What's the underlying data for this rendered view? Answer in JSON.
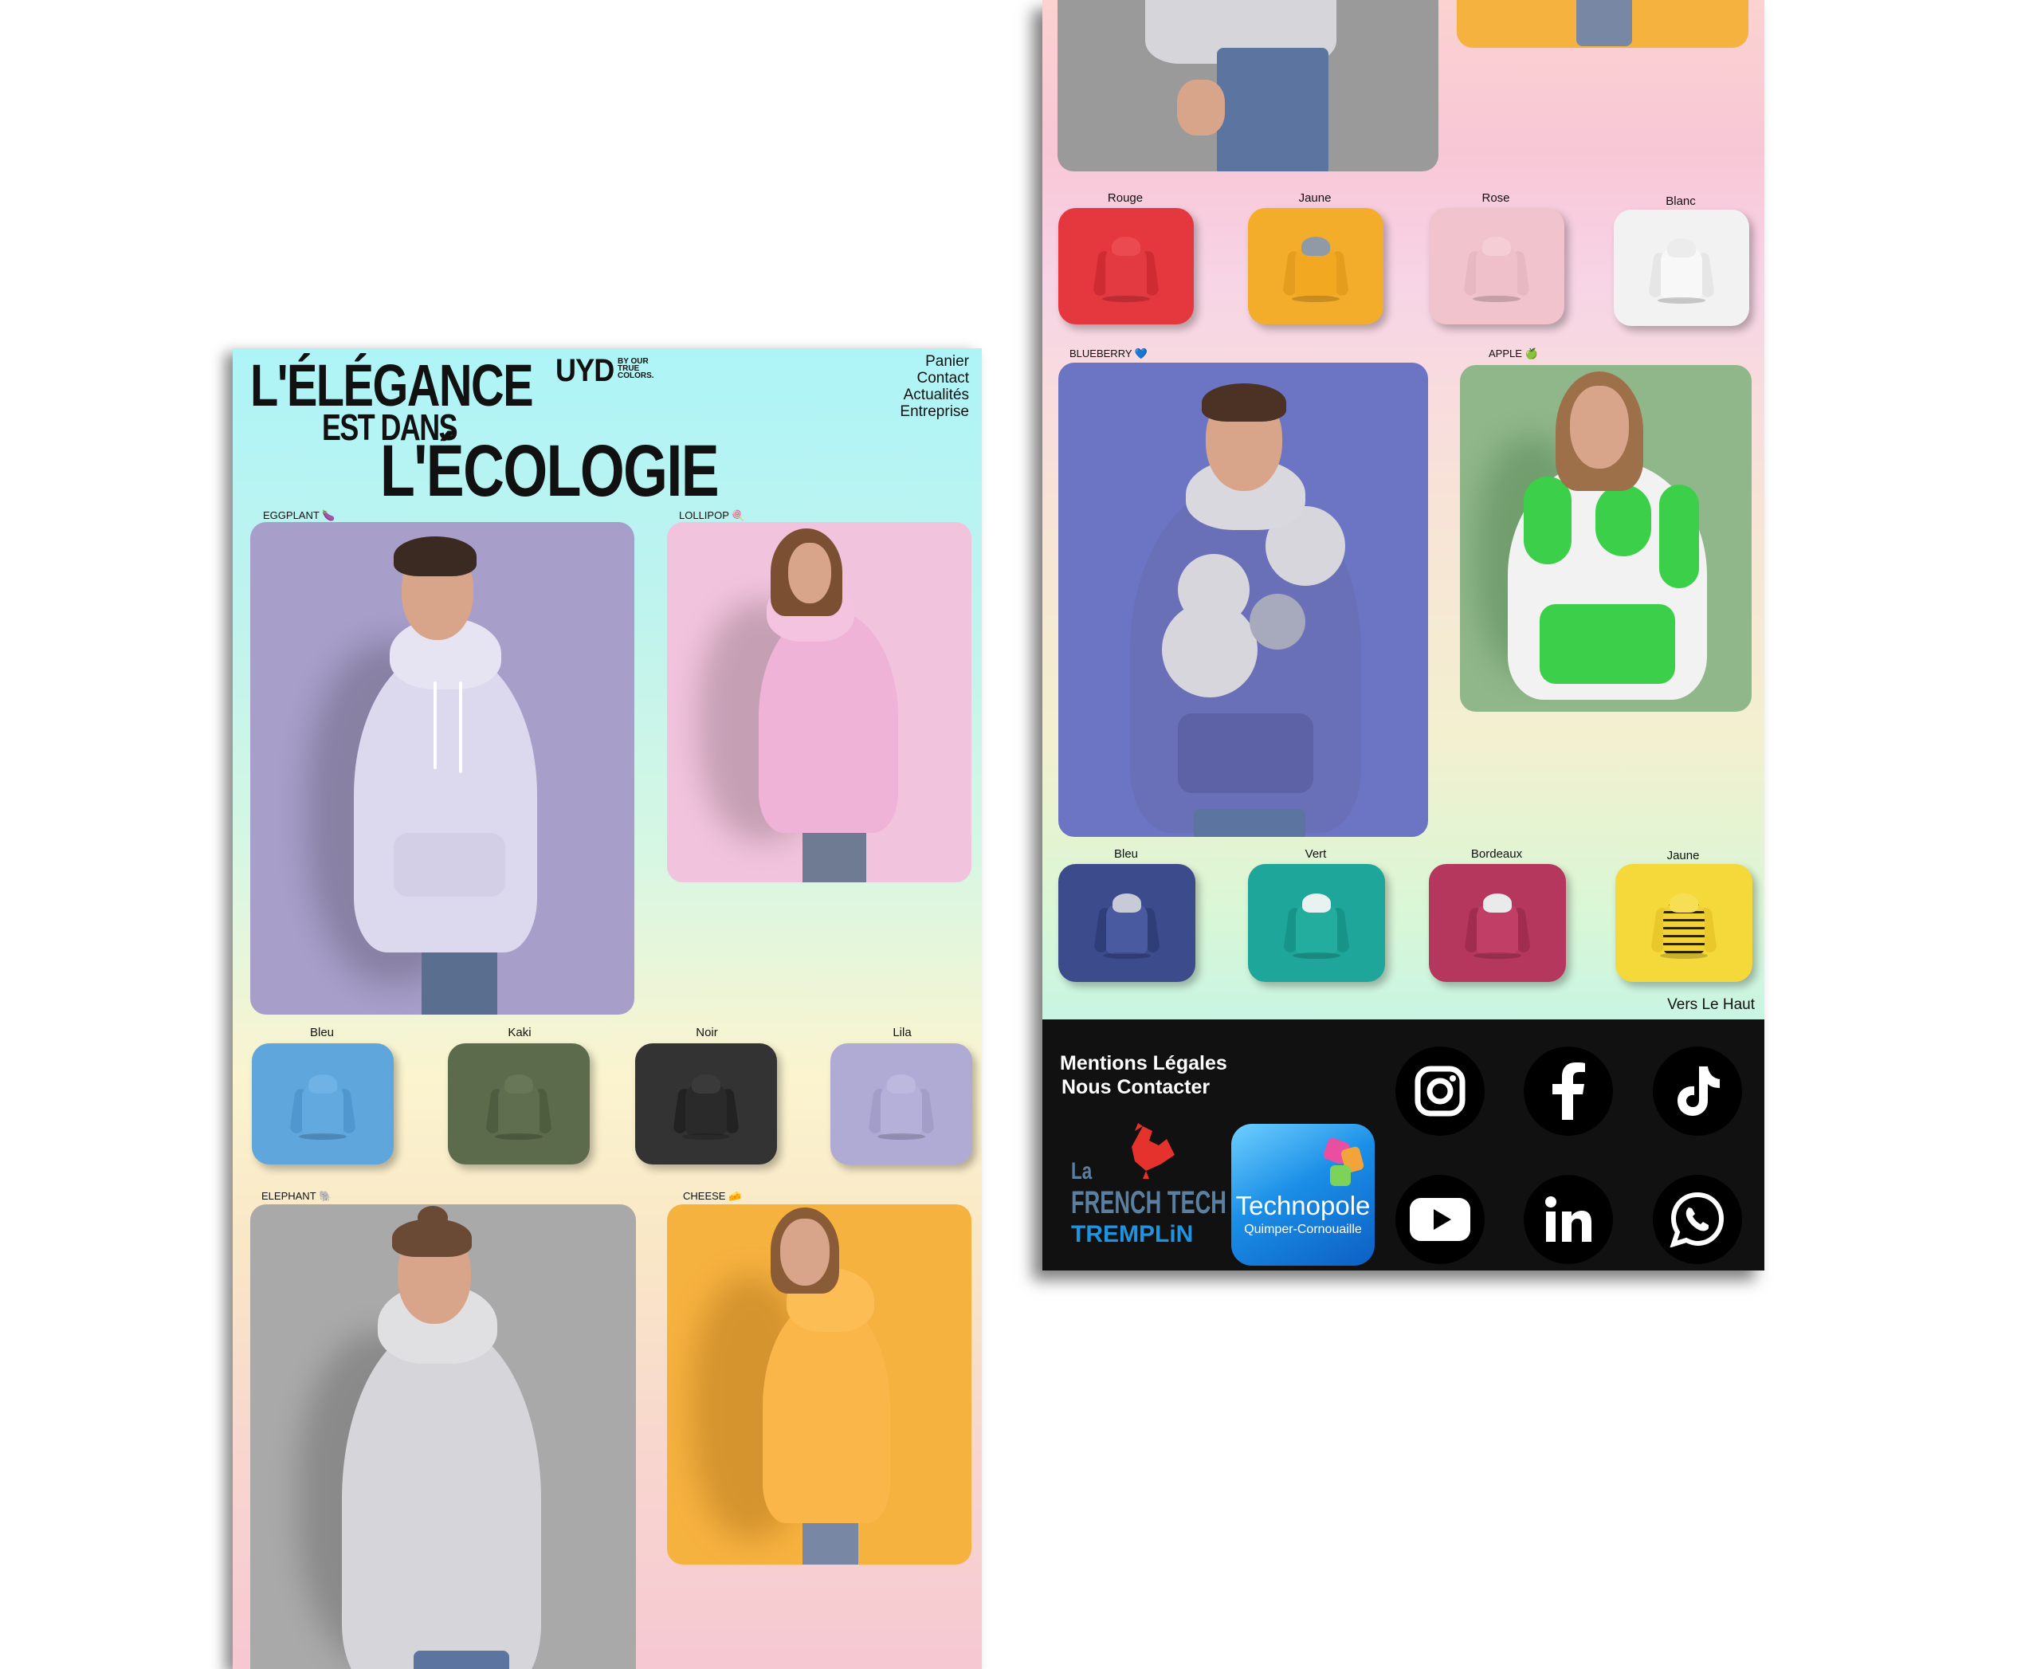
{
  "hero": {
    "line1": "L'ÉLÉGANCE",
    "line2": "EST DANS",
    "line3": "L'ÉCOLOGIE"
  },
  "brand": {
    "logo": "UYD",
    "tagline": "BY OUR TRUE COLORS."
  },
  "nav": {
    "items": [
      "Panier",
      "Contact",
      "Actualités",
      "Entreprise"
    ]
  },
  "left_products": [
    {
      "name": "EGGPLANT",
      "emoji": "🍆",
      "bg": "#a79ec9"
    },
    {
      "name": "LOLLIPOP",
      "emoji": "🍭",
      "bg": "#f1c3dc"
    },
    {
      "name": "ELEPHANT",
      "emoji": "🐘",
      "bg": "#a9a9a9"
    },
    {
      "name": "CHEESE",
      "emoji": "🧀",
      "bg": "#f6b23f"
    }
  ],
  "left_swatches": [
    {
      "label": "Bleu",
      "color": "#5fa6dc"
    },
    {
      "label": "Kaki",
      "color": "#5c6b4b"
    },
    {
      "label": "Noir",
      "color": "#333333"
    },
    {
      "label": "Lila",
      "color": "#b0abd4"
    }
  ],
  "right_swatches_top": [
    {
      "label": "Rouge",
      "color": "#e5383e"
    },
    {
      "label": "Jaune",
      "color": "#f4ad2b"
    },
    {
      "label": "Rose",
      "color": "#f1c4cd"
    },
    {
      "label": "Blanc",
      "color": "#f2f2f2"
    }
  ],
  "right_products": [
    {
      "name": "BLUEBERRY",
      "emoji": "💙",
      "bg": "#6b75c4"
    },
    {
      "name": "APPLE",
      "emoji": "🍏",
      "bg": "#8fb78a"
    }
  ],
  "right_swatches_bottom": [
    {
      "label": "Bleu",
      "color": "#3b4b8b"
    },
    {
      "label": "Vert",
      "color": "#1fa69a"
    },
    {
      "label": "Bordeaux",
      "color": "#b6375e"
    },
    {
      "label": "Jaune",
      "color": "#f5d83a"
    }
  ],
  "back_to_top": "Vers Le Haut",
  "footer": {
    "legal": "Mentions Légales",
    "contact": "Nous Contacter",
    "frenchtech": {
      "line1": "La",
      "line2": "FRENCH TECH",
      "line3": "TREMPLiN"
    },
    "technopole": {
      "title": "Technopole",
      "subtitle": "Quimper-Cornouaille"
    },
    "socials": [
      "instagram-icon",
      "facebook-icon",
      "tiktok-icon",
      "youtube-icon",
      "linkedin-icon",
      "whatsapp-icon"
    ]
  }
}
